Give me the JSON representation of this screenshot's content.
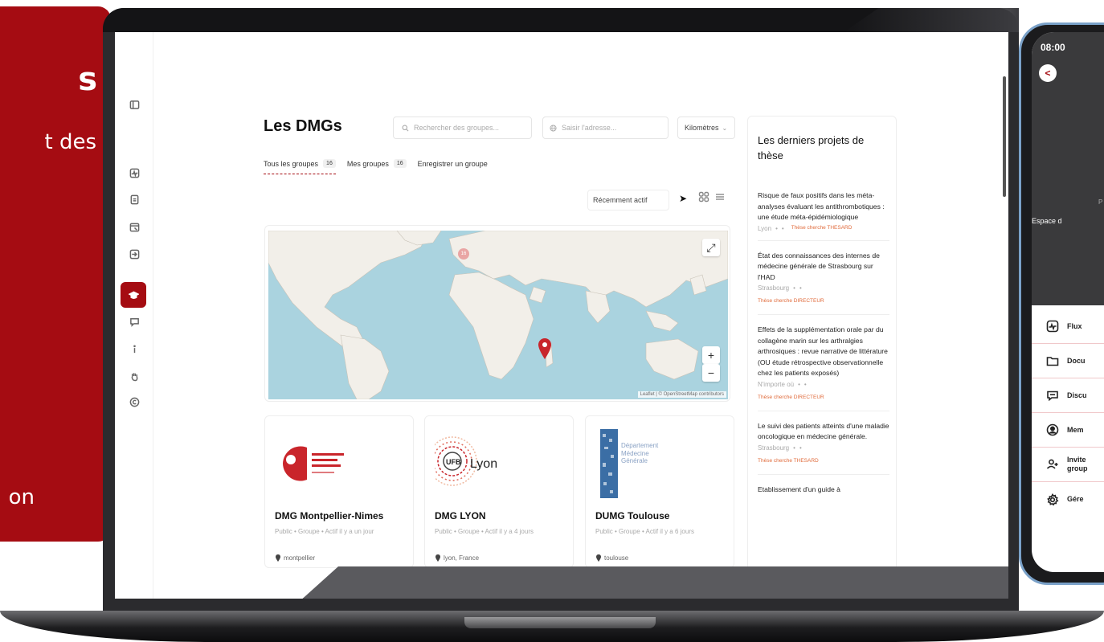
{
  "promo": {
    "title_fragment": "s",
    "line1_fragment": "t des",
    "line2_fragment": "on"
  },
  "app": {
    "page_title": "Les DMGs",
    "search_placeholder": "Rechercher des groupes...",
    "address_placeholder": "Saisir l'adresse...",
    "unit_label": "Kilomètres",
    "tabs": [
      {
        "label": "Tous les groupes",
        "count": "16"
      },
      {
        "label": "Mes groupes",
        "count": "16"
      },
      {
        "label": "Enregistrer un groupe"
      }
    ],
    "sort_label": "Récemment actif",
    "map": {
      "attribution": "Leaflet | © OpenStreetMap contributors",
      "zoom_in": "+",
      "zoom_out": "−",
      "cluster_count": "16"
    },
    "cards": [
      {
        "name": "DMG Montpellier-Nimes",
        "meta": "Public • Groupe • Actif il y a un jour",
        "location": "montpellier"
      },
      {
        "name": "DMG LYON",
        "meta": "Public • Groupe • Actif il y a 4 jours",
        "location": "lyon, France",
        "logo_text": "Lyon"
      },
      {
        "name": "DUMG Toulouse",
        "meta": "Public • Groupe • Actif il y a 6 jours",
        "location": "toulouse",
        "logo_text": "Département Médecine Générale"
      }
    ],
    "right_panel": {
      "title": "Les derniers projets de thèse",
      "items": [
        {
          "title": "Risque de faux positifs dans les méta-analyses évaluant les antithrombotiques : une étude méta-épidémiologique",
          "location": "Lyon",
          "badge": "Thèse cherche THESARD"
        },
        {
          "title": "État des connaissances des internes de médecine générale de Strasbourg sur l'HAD",
          "location": "Strasbourg",
          "badge": "Thèse cherche DIRECTEUR"
        },
        {
          "title": "Effets de la supplémentation orale par du collagène marin sur les arthralgies arthrosiques : revue narrative de littérature (OU étude rétrospective observationnelle chez les patients exposés)",
          "location": "N'importe où",
          "badge": "Thèse cherche DIRECTEUR"
        },
        {
          "title": "Le suivi des patients atteints d'une maladie oncologique en médecine générale.",
          "location": "Strasbourg",
          "badge": "Thèse cherche THESARD"
        },
        {
          "title": "Etablissement d'un guide à",
          "location": "",
          "badge": ""
        }
      ]
    }
  },
  "phone": {
    "time": "08:00",
    "back_label": "<",
    "sub1": "P",
    "sub2": "Espace d",
    "menu": [
      {
        "label": "Flux",
        "icon": "activity-icon"
      },
      {
        "label": "Docu",
        "icon": "folder-icon"
      },
      {
        "label": "Discu",
        "icon": "chat-icon"
      },
      {
        "label": "Mem",
        "icon": "user-circle-icon"
      },
      {
        "label": "Invite\ngroup",
        "icon": "user-add-icon"
      },
      {
        "label": "Gére",
        "icon": "gear-icon"
      }
    ]
  },
  "colors": {
    "brand": "#a50c12",
    "badge": "#e06a3a",
    "map_water": "#aad3df",
    "map_land": "#f2efe9"
  }
}
